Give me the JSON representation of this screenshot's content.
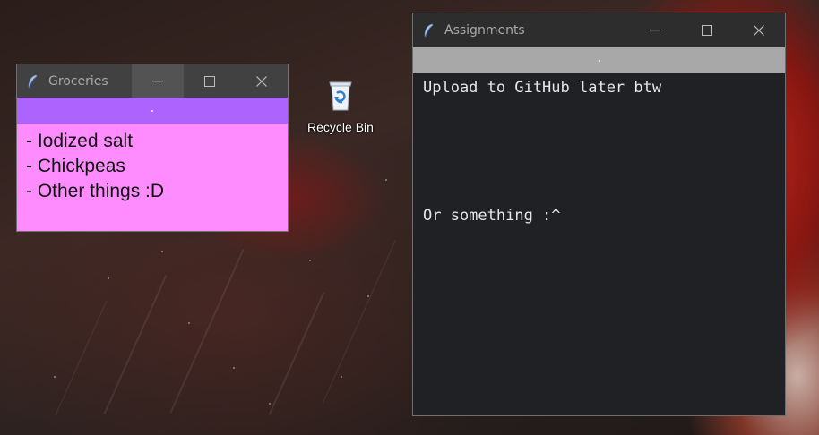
{
  "desktop": {
    "icons": [
      {
        "label": "Recycle Bin",
        "icon": "recycle-bin-icon"
      }
    ]
  },
  "groceries_window": {
    "title": "Groceries",
    "app_icon": "feather-icon",
    "lines": [
      "- Iodized salt",
      "- Chickpeas",
      "- Other things :D"
    ],
    "colors": {
      "body": "#ff8cff",
      "handle": "#ad64ff",
      "titlebar": "#414141"
    }
  },
  "assignments_window": {
    "title": "Assignments",
    "app_icon": "feather-icon",
    "lines": [
      "Upload to GitHub later btw",
      "Or something :^"
    ],
    "colors": {
      "body": "#1f2124",
      "handle": "#a8a8a8",
      "text": "#e6e6e6",
      "titlebar": "#2d2d2d"
    }
  },
  "window_controls": [
    "minimize-icon",
    "maximize-icon",
    "close-icon"
  ]
}
